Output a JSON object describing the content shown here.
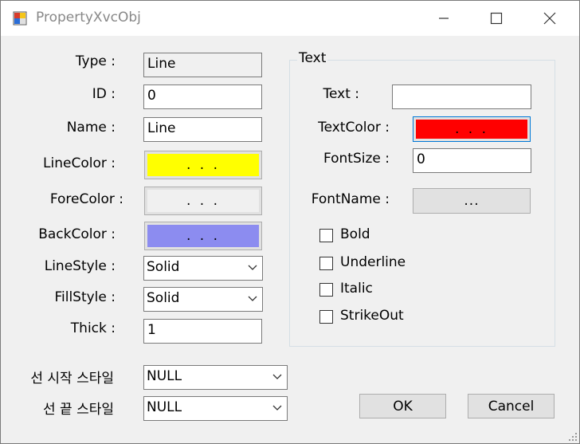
{
  "window": {
    "title": "PropertyXvcObj"
  },
  "icons": {
    "app": "app-icon",
    "minimize": "minimize-icon",
    "maximize": "maximize-icon",
    "close": "close-icon",
    "dropdown": "chevron-down-icon",
    "grip": "resize-grip-icon"
  },
  "colors": {
    "line_color": "#ffff00",
    "fore_color": "#f0f0f0",
    "back_color": "#8c8cf0",
    "text_color": "#ff0000"
  },
  "left": {
    "type_label": "Type :",
    "type_value": "Line",
    "id_label": "ID :",
    "id_value": "0",
    "name_label": "Name :",
    "name_value": "Line",
    "linecolor_label": "LineColor :",
    "linecolor_btn": ". . .",
    "forecolor_label": "ForeColor :",
    "forecolor_btn": ". . .",
    "backcolor_label": "BackColor :",
    "backcolor_btn": ". . .",
    "linestyle_label": "LineStyle :",
    "linestyle_value": "Solid",
    "fillstyle_label": "FillStyle :",
    "fillstyle_value": "Solid",
    "thick_label": "Thick :",
    "thick_value": "1",
    "start_style_label": "선 시작 스타일",
    "start_style_value": "NULL",
    "end_style_label": "선 끝 스타일",
    "end_style_value": "NULL"
  },
  "text_group": {
    "title": "Text",
    "text_label": "Text :",
    "text_value": "",
    "textcolor_label": "TextColor :",
    "textcolor_btn": ". . .",
    "fontsize_label": "FontSize :",
    "fontsize_value": "0",
    "fontname_label": "FontName :",
    "fontname_btn": "...",
    "bold": {
      "label": "Bold",
      "checked": false
    },
    "underline": {
      "label": "Underline",
      "checked": false
    },
    "italic": {
      "label": "Italic",
      "checked": false
    },
    "strikeout": {
      "label": "StrikeOut",
      "checked": false
    }
  },
  "buttons": {
    "ok": "OK",
    "cancel": "Cancel"
  }
}
